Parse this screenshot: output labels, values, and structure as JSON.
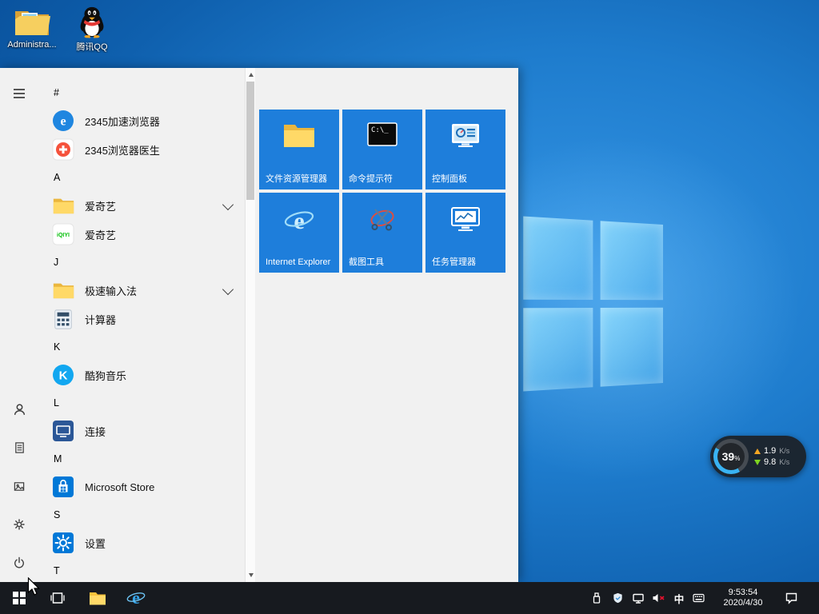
{
  "desktop": {
    "icons": [
      {
        "label": "Administra...",
        "icon": "user-folder-icon"
      },
      {
        "label": "腾讯QQ",
        "icon": "qq-penguin-icon"
      }
    ]
  },
  "start_menu": {
    "app_list": [
      {
        "type": "header",
        "label": "#"
      },
      {
        "type": "app",
        "label": "2345加速浏览器",
        "icon": "browser-2345-icon"
      },
      {
        "type": "app",
        "label": "2345浏览器医生",
        "icon": "doctor-2345-icon"
      },
      {
        "type": "header",
        "label": "A"
      },
      {
        "type": "folder",
        "label": "爱奇艺",
        "icon": "folder-icon"
      },
      {
        "type": "app",
        "label": "爱奇艺",
        "icon": "iqiyi-icon"
      },
      {
        "type": "header",
        "label": "J"
      },
      {
        "type": "folder",
        "label": "极速输入法",
        "icon": "folder-icon"
      },
      {
        "type": "app",
        "label": "计算器",
        "icon": "calculator-icon"
      },
      {
        "type": "header",
        "label": "K"
      },
      {
        "type": "app",
        "label": "酷狗音乐",
        "icon": "kugou-icon"
      },
      {
        "type": "header",
        "label": "L"
      },
      {
        "type": "app",
        "label": "连接",
        "icon": "connect-icon"
      },
      {
        "type": "header",
        "label": "M"
      },
      {
        "type": "app",
        "label": "Microsoft Store",
        "icon": "store-icon"
      },
      {
        "type": "header",
        "label": "S"
      },
      {
        "type": "app",
        "label": "设置",
        "icon": "settings-icon"
      },
      {
        "type": "header",
        "label": "T"
      }
    ],
    "tiles": [
      {
        "label": "文件资源管理器",
        "icon": "file-explorer-icon"
      },
      {
        "label": "命令提示符",
        "icon": "command-prompt-icon"
      },
      {
        "label": "控制面板",
        "icon": "control-panel-icon"
      },
      {
        "label": "Internet Explorer",
        "icon": "internet-explorer-icon"
      },
      {
        "label": "截图工具",
        "icon": "snipping-tool-icon"
      },
      {
        "label": "任务管理器",
        "icon": "task-manager-icon"
      }
    ],
    "rail_icons": [
      "hamburger-icon",
      "user-icon",
      "document-icon",
      "pictures-icon",
      "gear-icon",
      "power-icon"
    ]
  },
  "net_widget": {
    "percent": "39",
    "percent_unit": "%",
    "upload_value": "1.9",
    "upload_unit": "K/s",
    "download_value": "9.8",
    "download_unit": "K/s"
  },
  "taskbar": {
    "ime_mode": "中",
    "clock": {
      "time": "9:53:54",
      "date": "2020/4/30"
    }
  },
  "colors": {
    "tile_blue": "#1e7edb",
    "taskbar_bg": "#171a1f",
    "menu_bg": "#f1f1f1",
    "accent": "#0078d7"
  }
}
